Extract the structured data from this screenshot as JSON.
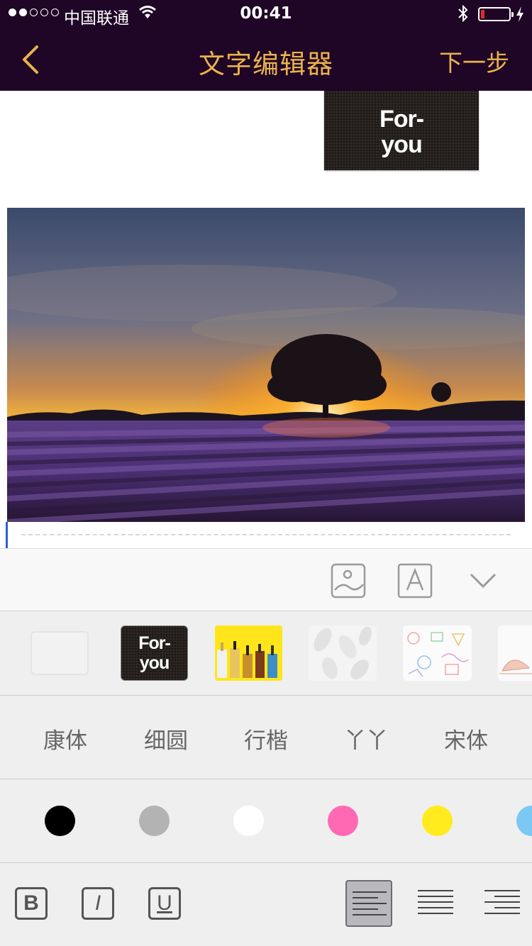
{
  "status_bar": {
    "carrier": "中国联通",
    "time": "00:41",
    "signal_bars_filled": 2,
    "signal_bars_total": 5,
    "battery_level": 0.12,
    "battery_color": "#e12b2b"
  },
  "nav": {
    "title": "文字编辑器",
    "next_label": "下一步",
    "accent_color": "#e9b34d"
  },
  "content": {
    "card_text_line1": "For-",
    "card_text_line2": "you",
    "photo_icon": "lavender-field-sunset-photo"
  },
  "toolbar": {
    "icons": [
      "image-icon",
      "text-icon",
      "chevron-down-icon"
    ]
  },
  "backgrounds": {
    "items": [
      {
        "name": "blank"
      },
      {
        "name": "for-you",
        "line1": "For-",
        "line2": "you"
      },
      {
        "name": "bottles-yellow"
      },
      {
        "name": "leaf-pattern"
      },
      {
        "name": "doodle-pattern"
      },
      {
        "name": "shell-pattern"
      }
    ]
  },
  "fonts": {
    "items": [
      "康体",
      "细圆",
      "行楷",
      "丫丫",
      "宋体"
    ]
  },
  "colors": {
    "items": [
      "#000000",
      "#b3b3b3",
      "#ffffff",
      "#ff69b4",
      "#ffeb1e",
      "#7cc8f5"
    ]
  },
  "text_style": {
    "bold": "B",
    "italic": "I",
    "underline": "U",
    "alignments": [
      "left",
      "center",
      "right"
    ],
    "selected_alignment": "left"
  }
}
